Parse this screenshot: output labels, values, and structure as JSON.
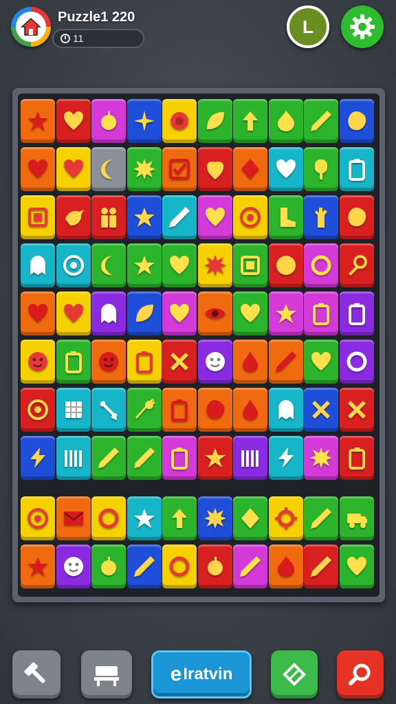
{
  "header": {
    "title": "Puzzle1 220",
    "progress_text": "11",
    "level_label": "L"
  },
  "palette": {
    "red": "#d82020",
    "orange": "#f06a10",
    "yellow": "#f7d000",
    "green": "#2cb52c",
    "teal": "#16b6c8",
    "blue": "#1f4fd8",
    "purple": "#8a2be2",
    "magenta": "#d43ad8"
  },
  "board": {
    "top_rows": [
      [
        {
          "color": "orange",
          "icon": "star"
        },
        {
          "color": "red",
          "icon": "heart"
        },
        {
          "color": "magenta",
          "icon": "apple"
        },
        {
          "color": "blue",
          "icon": "sparkle"
        },
        {
          "color": "yellow",
          "icon": "badge"
        },
        {
          "color": "green",
          "icon": "leaf"
        },
        {
          "color": "green",
          "icon": "arrow"
        },
        {
          "color": "green",
          "icon": "flame"
        },
        {
          "color": "green",
          "icon": "pencil"
        },
        {
          "color": "blue",
          "icon": "blob"
        }
      ],
      [
        {
          "color": "orange",
          "icon": "heart"
        },
        {
          "color": "yellow",
          "icon": "heart"
        },
        {
          "color": "gray",
          "icon": "moon"
        },
        {
          "color": "green",
          "icon": "splat"
        },
        {
          "color": "orange",
          "icon": "checkbox"
        },
        {
          "color": "red",
          "icon": "strawberry"
        },
        {
          "color": "orange",
          "icon": "diamond"
        },
        {
          "color": "teal",
          "icon": "heart"
        },
        {
          "color": "green",
          "icon": "popsicle"
        },
        {
          "color": "teal",
          "icon": "battery"
        }
      ],
      [
        {
          "color": "yellow",
          "icon": "square"
        },
        {
          "color": "red",
          "icon": "bird"
        },
        {
          "color": "red",
          "icon": "people"
        },
        {
          "color": "blue",
          "icon": "star"
        },
        {
          "color": "teal",
          "icon": "pencil"
        },
        {
          "color": "magenta",
          "icon": "heart"
        },
        {
          "color": "yellow",
          "icon": "target"
        },
        {
          "color": "green",
          "icon": "boot"
        },
        {
          "color": "blue",
          "icon": "hand"
        },
        {
          "color": "red",
          "icon": "blob"
        }
      ],
      [
        {
          "color": "teal",
          "icon": "ghost"
        },
        {
          "color": "teal",
          "icon": "target"
        },
        {
          "color": "green",
          "icon": "moon"
        },
        {
          "color": "green",
          "icon": "star"
        },
        {
          "color": "green",
          "icon": "heart"
        },
        {
          "color": "yellow",
          "icon": "splat"
        },
        {
          "color": "green",
          "icon": "square"
        },
        {
          "color": "red",
          "icon": "ball"
        },
        {
          "color": "magenta",
          "icon": "ring"
        },
        {
          "color": "red",
          "icon": "key"
        }
      ],
      [
        {
          "color": "orange",
          "icon": "heart"
        },
        {
          "color": "yellow",
          "icon": "heart"
        },
        {
          "color": "purple",
          "icon": "ghost"
        },
        {
          "color": "blue",
          "icon": "leaf"
        },
        {
          "color": "magenta",
          "icon": "heart"
        },
        {
          "color": "orange",
          "icon": "eye"
        },
        {
          "color": "green",
          "icon": "heart"
        },
        {
          "color": "magenta",
          "icon": "star"
        },
        {
          "color": "magenta",
          "icon": "battery"
        },
        {
          "color": "purple",
          "icon": "battery"
        }
      ],
      [
        {
          "color": "yellow",
          "icon": "face"
        },
        {
          "color": "green",
          "icon": "battery"
        },
        {
          "color": "orange",
          "icon": "face"
        },
        {
          "color": "yellow",
          "icon": "battery"
        },
        {
          "color": "red",
          "icon": "cross"
        },
        {
          "color": "purple",
          "icon": "face"
        },
        {
          "color": "orange",
          "icon": "drop"
        },
        {
          "color": "orange",
          "icon": "pencil"
        },
        {
          "color": "green",
          "icon": "heart"
        },
        {
          "color": "purple",
          "icon": "ring"
        }
      ],
      [
        {
          "color": "red",
          "icon": "target"
        },
        {
          "color": "teal",
          "icon": "grid"
        },
        {
          "color": "teal",
          "icon": "bone"
        },
        {
          "color": "green",
          "icon": "carrot"
        },
        {
          "color": "orange",
          "icon": "battery"
        },
        {
          "color": "orange",
          "icon": "blob"
        },
        {
          "color": "orange",
          "icon": "drop"
        },
        {
          "color": "teal",
          "icon": "ghost"
        },
        {
          "color": "blue",
          "icon": "cross"
        },
        {
          "color": "red",
          "icon": "cross"
        }
      ],
      [
        {
          "color": "blue",
          "icon": "bolt"
        },
        {
          "color": "teal",
          "icon": "bars"
        },
        {
          "color": "green",
          "icon": "pencil"
        },
        {
          "color": "green",
          "icon": "pencil"
        },
        {
          "color": "magenta",
          "icon": "battery"
        },
        {
          "color": "red",
          "icon": "star"
        },
        {
          "color": "purple",
          "icon": "bars"
        },
        {
          "color": "teal",
          "icon": "bolt"
        },
        {
          "color": "magenta",
          "icon": "splat"
        },
        {
          "color": "red",
          "icon": "battery"
        }
      ]
    ],
    "bottom_rows": [
      [
        {
          "color": "yellow",
          "icon": "target"
        },
        {
          "color": "orange",
          "icon": "envelope"
        },
        {
          "color": "yellow",
          "icon": "ring"
        },
        {
          "color": "teal",
          "icon": "star"
        },
        {
          "color": "green",
          "icon": "arrow"
        },
        {
          "color": "blue",
          "icon": "splat"
        },
        {
          "color": "green",
          "icon": "diamond"
        },
        {
          "color": "yellow",
          "icon": "gear"
        },
        {
          "color": "green",
          "icon": "pencil"
        },
        {
          "color": "green",
          "icon": "truck"
        }
      ],
      [
        {
          "color": "orange",
          "icon": "star"
        },
        {
          "color": "purple",
          "icon": "face"
        },
        {
          "color": "green",
          "icon": "apple"
        },
        {
          "color": "blue",
          "icon": "pencil"
        },
        {
          "color": "yellow",
          "icon": "ring"
        },
        {
          "color": "red",
          "icon": "apple"
        },
        {
          "color": "magenta",
          "icon": "pencil"
        },
        {
          "color": "orange",
          "icon": "flame"
        },
        {
          "color": "red",
          "icon": "pencil"
        },
        {
          "color": "green",
          "icon": "heart"
        }
      ]
    ]
  },
  "bottom_bar": {
    "main_label": "Iratvin",
    "main_glyph": "e",
    "buttons": [
      "hammer-icon",
      "bench-icon",
      "diamond-icon",
      "search-icon"
    ]
  }
}
